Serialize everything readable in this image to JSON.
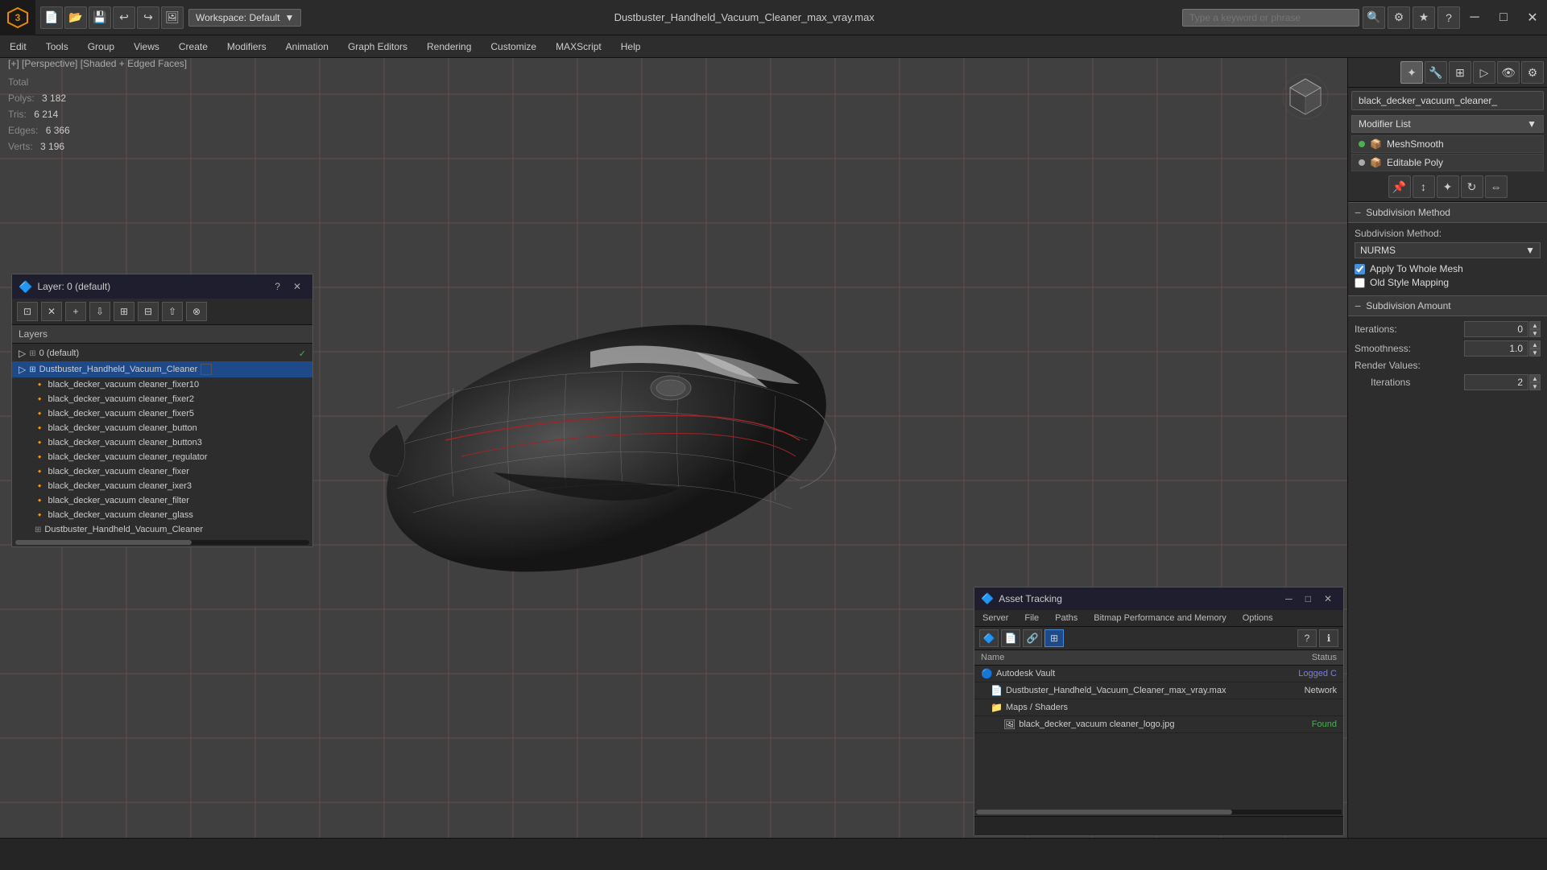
{
  "topbar": {
    "logo": "3",
    "workspace_label": "Workspace: Default",
    "file_title": "Dustbuster_Handheld_Vacuum_Cleaner_max_vray.max",
    "search_placeholder": "Type a keyword or phrase",
    "window_controls": [
      "─",
      "□",
      "✕"
    ]
  },
  "menubar": {
    "items": [
      "Edit",
      "Tools",
      "Group",
      "Views",
      "Create",
      "Modifiers",
      "Animation",
      "Graph Editors",
      "Rendering",
      "Customize",
      "MAXScript",
      "Help"
    ]
  },
  "viewport": {
    "label": "[+] [Perspective] [Shaded + Edged Faces]",
    "stats": {
      "polys_label": "Polys:",
      "polys_value": "3 182",
      "tris_label": "Tris:",
      "tris_value": "6 214",
      "edges_label": "Edges:",
      "edges_value": "6 366",
      "verts_label": "Verts:",
      "verts_value": "3 196",
      "total_label": "Total"
    }
  },
  "right_panel": {
    "object_name": "black_decker_vacuum_cleaner_",
    "modifier_list_label": "Modifier List",
    "modifiers": [
      {
        "name": "MeshSmooth",
        "active": true
      },
      {
        "name": "Editable Poly",
        "active": false
      }
    ],
    "subdivision_method_section": "Subdivision Method",
    "subdivision_method_label": "Subdivision Method:",
    "subdivision_method_value": "NURMS",
    "apply_whole_mesh_label": "Apply To Whole Mesh",
    "old_style_mapping_label": "Old Style Mapping",
    "subdivision_amount_section": "Subdivision Amount",
    "iterations_label": "Iterations:",
    "iterations_value": "0",
    "smoothness_label": "Smoothness:",
    "smoothness_value": "1.0",
    "render_values_label": "Render Values:",
    "render_iterations_label": "Iterations",
    "render_iterations_value": "2"
  },
  "layer_dialog": {
    "title": "Layer: 0 (default)",
    "help_btn": "?",
    "close_btn": "✕",
    "header_label": "Layers",
    "layers": [
      {
        "name": "0 (default)",
        "indent": 0,
        "checked": true
      },
      {
        "name": "Dustbuster_Handheld_Vacuum_Cleaner",
        "indent": 0,
        "selected": true
      },
      {
        "name": "black_decker_vacuum cleaner_fixer10",
        "indent": 1
      },
      {
        "name": "black_decker_vacuum cleaner_fixer2",
        "indent": 1
      },
      {
        "name": "black_decker_vacuum cleaner_fixer5",
        "indent": 1
      },
      {
        "name": "black_decker_vacuum cleaner_button",
        "indent": 1
      },
      {
        "name": "black_decker_vacuum cleaner_button3",
        "indent": 1
      },
      {
        "name": "black_decker_vacuum cleaner_regulator",
        "indent": 1
      },
      {
        "name": "black_decker_vacuum cleaner_fixer",
        "indent": 1
      },
      {
        "name": "black_decker_vacuum cleaner_ixer3",
        "indent": 1
      },
      {
        "name": "black_decker_vacuum cleaner_filter",
        "indent": 1
      },
      {
        "name": "black_decker_vacuum cleaner_glass",
        "indent": 1
      },
      {
        "name": "Dustbuster_Handheld_Vacuum_Cleaner",
        "indent": 1
      }
    ]
  },
  "asset_dialog": {
    "title": "Asset Tracking",
    "menu_items": [
      "Server",
      "File",
      "Paths",
      "Bitmap Performance and Memory",
      "Options"
    ],
    "col_name": "Name",
    "col_status": "Status",
    "rows": [
      {
        "icon": "🔵",
        "name": "Autodesk Vault",
        "indent": 0,
        "status": "Logged C",
        "status_class": "status-logged"
      },
      {
        "icon": "📄",
        "name": "Dustbuster_Handheld_Vacuum_Cleaner_max_vray.max",
        "indent": 1,
        "status": "Network",
        "status_class": "status-network"
      },
      {
        "icon": "📁",
        "name": "Maps / Shaders",
        "indent": 1,
        "status": "",
        "status_class": ""
      },
      {
        "icon": "🖼",
        "name": "black_decker_vacuum cleaner_logo.jpg",
        "indent": 2,
        "status": "Found",
        "status_class": "status-found"
      }
    ]
  },
  "bottom_bar": {
    "text": ""
  }
}
